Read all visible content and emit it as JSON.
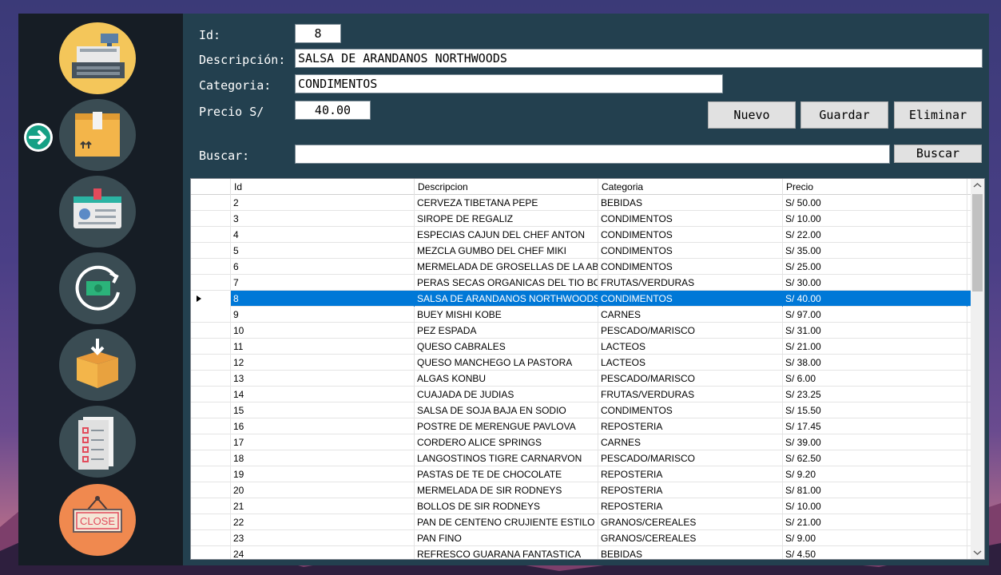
{
  "form": {
    "id_label": "Id:",
    "id_value": "8",
    "desc_label": "Descripción:",
    "desc_value": "SALSA DE ARANDANOS NORTHWOODS",
    "cat_label": "Categoria:",
    "cat_value": "CONDIMENTOS",
    "price_label": "Precio S/",
    "price_value": "40.00",
    "search_label": "Buscar:",
    "search_value": ""
  },
  "buttons": {
    "nuevo": "Nuevo",
    "guardar": "Guardar",
    "eliminar": "Eliminar",
    "buscar": "Buscar"
  },
  "sidebar": {
    "items": [
      "cash-register-icon",
      "product-box-icon",
      "id-card-icon",
      "money-refresh-icon",
      "inbound-box-icon",
      "checklist-icon",
      "close-sign-icon"
    ],
    "close_text": "CLOSE",
    "active_index": 1
  },
  "table": {
    "columns": [
      "Id",
      "Descripcion",
      "Categoria",
      "Precio"
    ],
    "selected_id": "8",
    "rows": [
      [
        "2",
        "CERVEZA TIBETANA PEPE",
        "BEBIDAS",
        "S/ 50.00"
      ],
      [
        "3",
        "SIROPE DE REGALIZ",
        "CONDIMENTOS",
        "S/ 10.00"
      ],
      [
        "4",
        "ESPECIAS CAJUN DEL CHEF ANTON",
        "CONDIMENTOS",
        "S/ 22.00"
      ],
      [
        "5",
        "MEZCLA GUMBO DEL CHEF MIKI",
        "CONDIMENTOS",
        "S/ 35.00"
      ],
      [
        "6",
        "MERMELADA DE GROSELLAS DE LA ABU...",
        "CONDIMENTOS",
        "S/ 25.00"
      ],
      [
        "7",
        "PERAS SECAS ORGANICAS DEL TIO BOB",
        "FRUTAS/VERDURAS",
        "S/ 30.00"
      ],
      [
        "8",
        "SALSA DE ARANDANOS NORTHWOODS",
        "CONDIMENTOS",
        "S/ 40.00"
      ],
      [
        "9",
        "BUEY MISHI KOBE",
        "CARNES",
        "S/ 97.00"
      ],
      [
        "10",
        "PEZ ESPADA",
        "PESCADO/MARISCO",
        "S/ 31.00"
      ],
      [
        "11",
        "QUESO CABRALES",
        "LACTEOS",
        "S/ 21.00"
      ],
      [
        "12",
        "QUESO MANCHEGO LA PASTORA",
        "LACTEOS",
        "S/ 38.00"
      ],
      [
        "13",
        "ALGAS KONBU",
        "PESCADO/MARISCO",
        "S/ 6.00"
      ],
      [
        "14",
        "CUAJADA DE JUDIAS",
        "FRUTAS/VERDURAS",
        "S/ 23.25"
      ],
      [
        "15",
        "SALSA DE SOJA BAJA EN SODIO",
        "CONDIMENTOS",
        "S/ 15.50"
      ],
      [
        "16",
        "POSTRE DE MERENGUE PAVLOVA",
        "REPOSTERIA",
        "S/ 17.45"
      ],
      [
        "17",
        "CORDERO ALICE SPRINGS",
        "CARNES",
        "S/ 39.00"
      ],
      [
        "18",
        "LANGOSTINOS TIGRE CARNARVON",
        "PESCADO/MARISCO",
        "S/ 62.50"
      ],
      [
        "19",
        "PASTAS DE TE DE CHOCOLATE",
        "REPOSTERIA",
        "S/ 9.20"
      ],
      [
        "20",
        "MERMELADA DE SIR RODNEYS",
        "REPOSTERIA",
        "S/ 81.00"
      ],
      [
        "21",
        "BOLLOS DE SIR RODNEYS",
        "REPOSTERIA",
        "S/ 10.00"
      ],
      [
        "22",
        "PAN DE CENTENO CRUJIENTE ESTILO G...",
        "GRANOS/CEREALES",
        "S/ 21.00"
      ],
      [
        "23",
        "PAN FINO",
        "GRANOS/CEREALES",
        "S/ 9.00"
      ],
      [
        "24",
        "REFRESCO GUARANA FANTASTICA",
        "BEBIDAS",
        "S/ 4.50"
      ]
    ]
  },
  "colors": {
    "panel": "#23404f",
    "sidebar": "#161d25",
    "selection": "#0078d7",
    "close_orange": "#f0894f"
  }
}
